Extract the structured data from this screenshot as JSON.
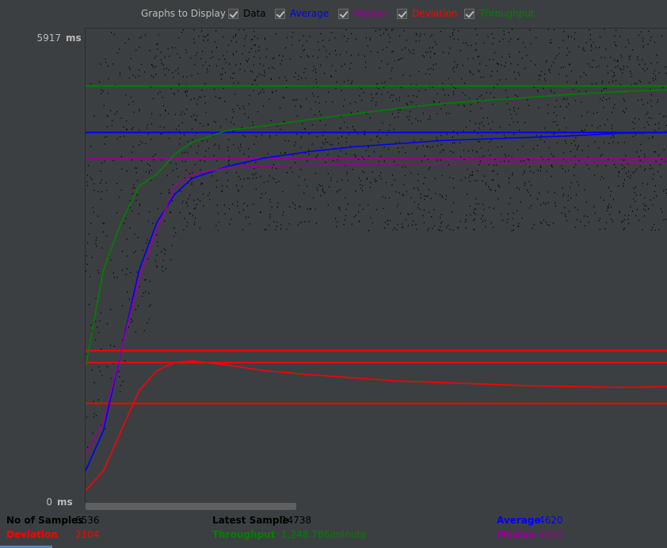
{
  "legend": {
    "title": "Graphs to Display",
    "items": [
      {
        "key": "data",
        "label": "Data",
        "color": "#000000",
        "checked": true
      },
      {
        "key": "average",
        "label": "Average",
        "color": "#0000ff",
        "checked": true
      },
      {
        "key": "median",
        "label": "Median",
        "color": "#990099",
        "checked": true
      },
      {
        "key": "deviation",
        "label": "Deviation",
        "color": "#ff0000",
        "checked": true
      },
      {
        "key": "throughput",
        "label": "Throughput",
        "color": "#008000",
        "checked": true
      }
    ]
  },
  "axis": {
    "y_max": "5917",
    "y_min": "0",
    "unit": "ms"
  },
  "chart_data": {
    "type": "scatter",
    "x_range": [
      0,
      6536
    ],
    "ylim": [
      0,
      5917
    ],
    "ylabel": "ms",
    "grid": false,
    "series": [
      {
        "name": "Data",
        "color": "#000000",
        "type": "scatter",
        "note": "dense points, mostly 3300-5917 ms after warm-up"
      },
      {
        "name": "Average",
        "color": "#0000ff",
        "type": "line",
        "x": [
          0,
          200,
          400,
          600,
          800,
          1000,
          1200,
          1600,
          2000,
          2500,
          3000,
          3500,
          4000,
          4500,
          5000,
          5500,
          6000,
          6536
        ],
        "y": [
          400,
          900,
          1900,
          2900,
          3500,
          3850,
          4050,
          4200,
          4300,
          4380,
          4440,
          4480,
          4520,
          4540,
          4560,
          4580,
          4610,
          4620
        ]
      },
      {
        "name": "Median",
        "color": "#990099",
        "type": "line",
        "x": [
          0,
          200,
          400,
          600,
          800,
          1000,
          1200,
          1600,
          2000,
          2500,
          3000,
          3500,
          4000,
          4500,
          5000,
          5500,
          6000,
          6536
        ],
        "y": [
          600,
          1000,
          1900,
          2800,
          3400,
          3950,
          4100,
          4180,
          4200,
          4210,
          4220,
          4230,
          4230,
          4240,
          4240,
          4240,
          4243,
          4243
        ]
      },
      {
        "name": "Deviation",
        "color": "#ff0000",
        "type": "line",
        "x": [
          0,
          200,
          400,
          600,
          800,
          1000,
          1200,
          1600,
          2000,
          2500,
          3000,
          3500,
          4000,
          4500,
          5000,
          5500,
          6000,
          6536
        ],
        "y": [
          150,
          400,
          900,
          1400,
          1650,
          1750,
          1770,
          1720,
          1650,
          1600,
          1560,
          1520,
          1500,
          1480,
          1460,
          1450,
          1440,
          1450
        ]
      },
      {
        "name": "Throughput",
        "color": "#008000",
        "type": "line",
        "x": [
          0,
          200,
          400,
          600,
          800,
          1000,
          1200,
          1600,
          2000,
          2500,
          3000,
          3500,
          4000,
          4500,
          5000,
          5500,
          6000,
          6536
        ],
        "y": [
          1700,
          2900,
          3500,
          3950,
          4100,
          4350,
          4500,
          4650,
          4700,
          4780,
          4850,
          4920,
          4980,
          5020,
          5060,
          5100,
          5130,
          5150
        ]
      }
    ],
    "reference_lines": [
      {
        "color": "#008000",
        "y": 5200
      },
      {
        "color": "#0000ff",
        "y": 4620
      },
      {
        "color": "#990099",
        "y": 4300
      },
      {
        "color": "#ff0000",
        "y": 1900
      },
      {
        "color": "#ff0000",
        "y": 1750
      },
      {
        "color": "#ff0000",
        "y": 1240
      }
    ]
  },
  "stats": {
    "samples_label": "No of Samples",
    "samples_value": "6536",
    "deviation_label": "Deviation",
    "deviation_value": "2104",
    "latest_label": "Latest Sample",
    "latest_value": "14738",
    "throughput_label": "Throughput",
    "throughput_value": "1,248.786/minute",
    "average_label": "Average",
    "average_value": "4620",
    "median_label": "Median",
    "median_value": "4243"
  }
}
